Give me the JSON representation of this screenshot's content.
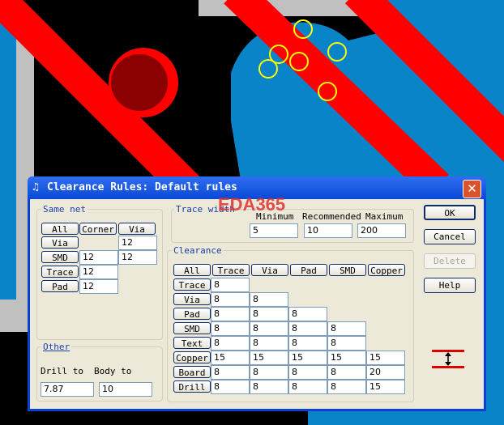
{
  "dialog": {
    "title": "Clearance Rules: Default rules",
    "close": "✕",
    "watermark": "EDA365"
  },
  "same_net": {
    "label": "Same net",
    "headers": [
      "All",
      "Corner",
      "Via"
    ],
    "rows": [
      {
        "label": "Via",
        "corner": "",
        "via": "12"
      },
      {
        "label": "SMD",
        "corner": "12",
        "via": "12"
      },
      {
        "label": "Trace",
        "corner": "12",
        "via": ""
      },
      {
        "label": "Pad",
        "corner": "12",
        "via": ""
      }
    ]
  },
  "trace_width": {
    "label": "Trace width",
    "minimum_label": "Minimum",
    "recommended_label": "Recommended",
    "maximum_label": "Maximum",
    "minimum": "5",
    "recommended": "10",
    "maximum": "200"
  },
  "clearance": {
    "label": "Clearance",
    "headers": [
      "All",
      "Trace",
      "Via",
      "Pad",
      "SMD",
      "Copper"
    ],
    "rows": [
      {
        "label": "Trace",
        "values": [
          "8"
        ]
      },
      {
        "label": "Via",
        "values": [
          "8",
          "8"
        ]
      },
      {
        "label": "Pad",
        "values": [
          "8",
          "8",
          "8"
        ]
      },
      {
        "label": "SMD",
        "values": [
          "8",
          "8",
          "8",
          "8"
        ]
      },
      {
        "label": "Text",
        "values": [
          "8",
          "8",
          "8",
          "8"
        ]
      },
      {
        "label": "Copper",
        "values": [
          "15",
          "15",
          "15",
          "15",
          "15"
        ]
      },
      {
        "label": "Board",
        "values": [
          "8",
          "8",
          "8",
          "8",
          "20"
        ]
      },
      {
        "label": "Drill",
        "values": [
          "8",
          "8",
          "8",
          "8",
          "15"
        ]
      }
    ]
  },
  "other": {
    "label": "Other",
    "drill_label": "Drill to",
    "body_label": "Body to",
    "drill": "7.87",
    "body": "10"
  },
  "buttons": {
    "ok": "OK",
    "cancel": "Cancel",
    "delete": "Delete",
    "help": "Help"
  }
}
